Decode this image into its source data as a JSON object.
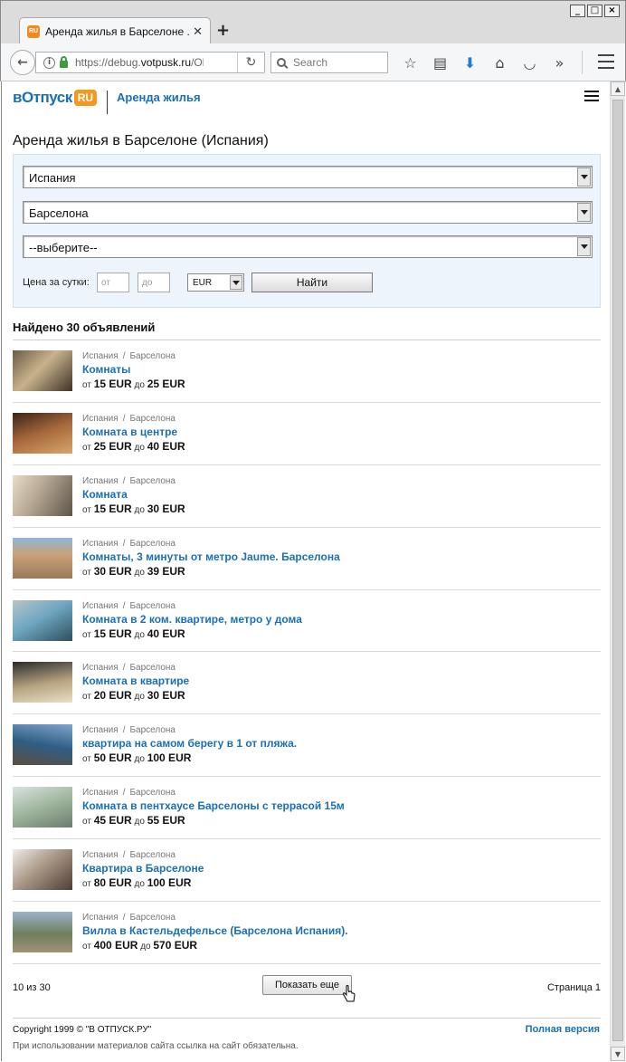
{
  "browser": {
    "tab_title": "Аренда жилья в Барселоне ...",
    "favicon_text": "RU",
    "url_prefix": "https://debug.",
    "url_domain": "votpusk.ru",
    "url_suffix": "/Ob",
    "search_placeholder": "Search"
  },
  "header": {
    "logo_text": "вОтпуск",
    "logo_badge": "RU",
    "section_link": "Аренда жилья"
  },
  "page_title": "Аренда жилья в Барселоне (Испания)",
  "search": {
    "country": "Испания",
    "city": "Барселона",
    "district": "--выберите--",
    "price_label": "Цена за сутки:",
    "price_from_placeholder": "от",
    "price_to_placeholder": "до",
    "currency": "EUR",
    "submit_label": "Найти"
  },
  "results": {
    "found_text": "Найдено 30 объявлений",
    "price_from_word": "от",
    "price_to_word": "до",
    "items": [
      {
        "country": "Испания",
        "city": "Барселона",
        "title": "Комнаты",
        "from": "15 EUR",
        "to": "25 EUR"
      },
      {
        "country": "Испания",
        "city": "Барселона",
        "title": "Комната в центре",
        "from": "25 EUR",
        "to": "40 EUR"
      },
      {
        "country": "Испания",
        "city": "Барселона",
        "title": "Комната",
        "from": "15 EUR",
        "to": "30 EUR"
      },
      {
        "country": "Испания",
        "city": "Барселона",
        "title": "Комнаты, 3 минуты от метро Jaume. Барселона",
        "from": "30 EUR",
        "to": "39 EUR"
      },
      {
        "country": "Испания",
        "city": "Барселона",
        "title": "Комната в 2 ком. квартире, метро у дома",
        "from": "15 EUR",
        "to": "40 EUR"
      },
      {
        "country": "Испания",
        "city": "Барселона",
        "title": "Комната в квартире",
        "from": "20 EUR",
        "to": "30 EUR"
      },
      {
        "country": "Испания",
        "city": "Барселона",
        "title": "квартира на самом берегу в 1 от пляжа.",
        "from": "50 EUR",
        "to": "100 EUR"
      },
      {
        "country": "Испания",
        "city": "Барселона",
        "title": "Комната в пентхаусе Барселоны с террасой 15м",
        "from": "45 EUR",
        "to": "55 EUR"
      },
      {
        "country": "Испания",
        "city": "Барселона",
        "title": "Квартира в Барселоне",
        "from": "80 EUR",
        "to": "100 EUR"
      },
      {
        "country": "Испания",
        "city": "Барселона",
        "title": "Вилла в Кастельдефельсе (Барселона Испания).",
        "from": "400 EUR",
        "to": "570 EUR"
      }
    ]
  },
  "pager": {
    "count_text": "10 из 30",
    "more_label": "Показать еще",
    "page_text": "Страница 1"
  },
  "footer": {
    "copyright": "Copyright 1999 © \"В ОТПУСК.РУ\"",
    "full_version": "Полная версия",
    "notice": "При использовании материалов сайта ссылка на сайт обязательна."
  }
}
